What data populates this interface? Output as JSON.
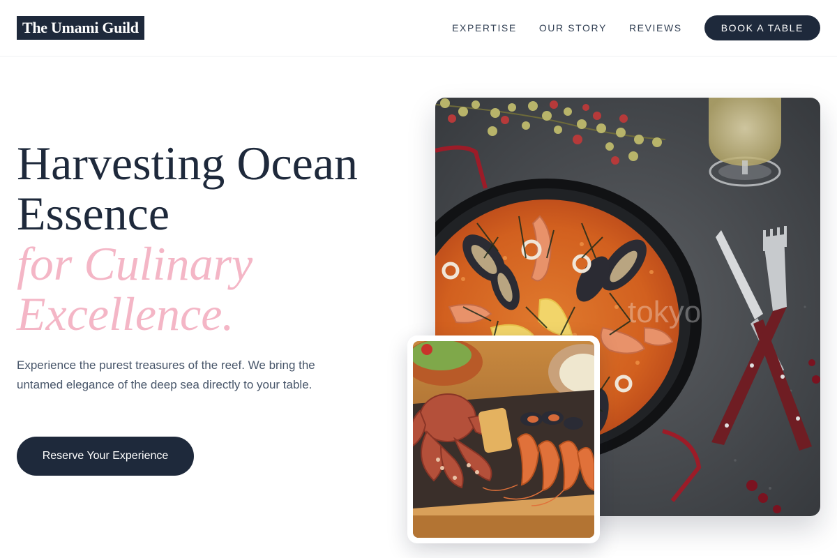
{
  "header": {
    "logo": "The Umami Guild",
    "nav": [
      "EXPERTISE",
      "OUR STORY",
      "REVIEWS"
    ],
    "cta": "BOOK A TABLE"
  },
  "hero": {
    "title_line1": "Harvesting Ocean",
    "title_line2": "Essence",
    "accent_line1": "for Culinary",
    "accent_line2": "Excellence.",
    "description": "Experience the purest treasures of the reef. We bring the untamed elegance of the deep sea directly to your table.",
    "cta": "Reserve Your Experience"
  },
  "images": {
    "main": "paella-seafood-photo",
    "secondary": "grilled-octopus-platter-photo",
    "watermark": "tokyo"
  },
  "colors": {
    "primary": "#1e293b",
    "accent": "#f4b6c6",
    "text_muted": "#475569"
  }
}
